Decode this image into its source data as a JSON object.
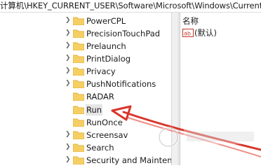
{
  "address_bar": {
    "path": "计算机\\HKEY_CURRENT_USER\\Software\\Microsoft\\Windows\\CurrentVer"
  },
  "tree": {
    "items": [
      {
        "label": "PowerCPL"
      },
      {
        "label": "PrecisionTouchPad"
      },
      {
        "label": "Prelaunch"
      },
      {
        "label": "PrintDialog"
      },
      {
        "label": "Privacy"
      },
      {
        "label": "PushNotifications"
      },
      {
        "label": "RADAR"
      },
      {
        "label": "Run",
        "selected": true
      },
      {
        "label": "RunOnce"
      },
      {
        "label": "Screensav"
      },
      {
        "label": "Search"
      },
      {
        "label": "Security and Mainten"
      }
    ]
  },
  "values_pane": {
    "column_name": "名称",
    "rows": [
      {
        "icon": "string-value-icon",
        "name": "(默认)"
      }
    ]
  },
  "colors": {
    "folder": "#f6cf64",
    "folder_shade": "#e3b33c",
    "arrow": "#d9362c"
  }
}
